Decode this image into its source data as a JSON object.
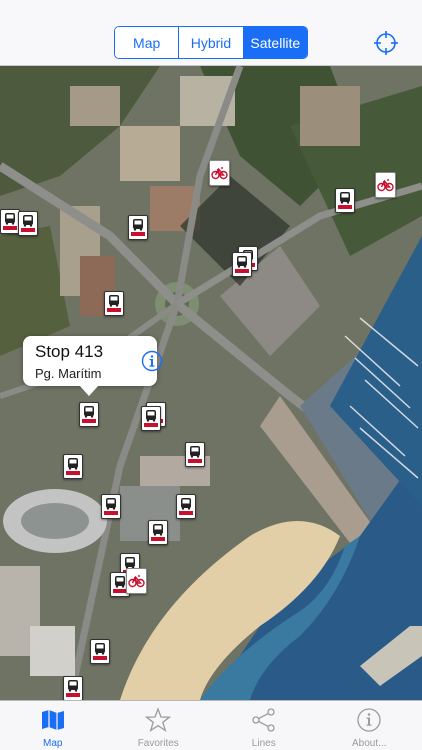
{
  "map_type": {
    "options": [
      "Map",
      "Hybrid",
      "Satellite"
    ],
    "selected": "Satellite"
  },
  "locate_icon": "crosshair-icon",
  "callout": {
    "title": "Stop 413",
    "subtitle": "Pg. Marítim",
    "info_icon": "info-icon"
  },
  "markers": {
    "bus_icon": "bus-stop-icon",
    "bike_icon": "bike-station-icon",
    "bus_color": "#c8102e"
  },
  "tabs": [
    {
      "label": "Map",
      "icon": "map-icon",
      "active": true
    },
    {
      "label": "Favorites",
      "icon": "star-icon",
      "active": false
    },
    {
      "label": "Lines",
      "icon": "share-nodes-icon",
      "active": false
    },
    {
      "label": "About...",
      "icon": "info-icon",
      "active": false
    }
  ],
  "colors": {
    "accent": "#1a6ef5",
    "inactive": "#9a9aa0"
  }
}
